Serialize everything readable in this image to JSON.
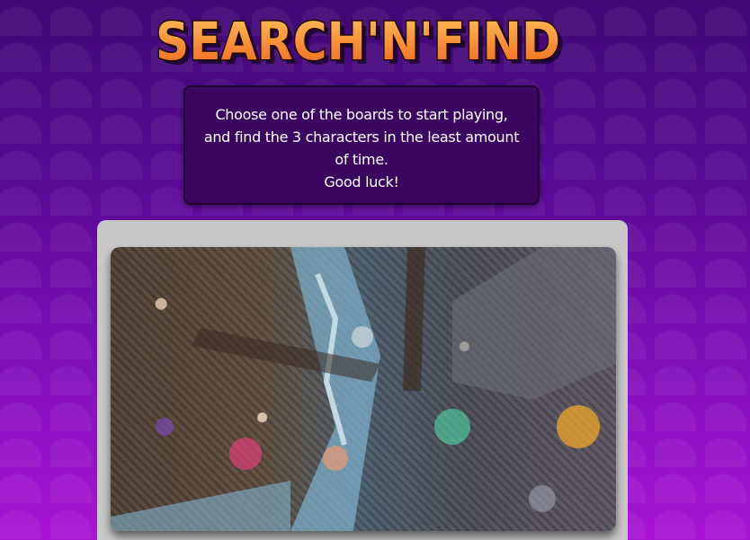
{
  "header": {
    "logo_text": "SEARCH'N'FIND"
  },
  "intro": {
    "line1": "Choose one of the boards to start playing, and find the 3 characters in the least amount of time.",
    "line2": "Good luck!"
  },
  "boards": [
    {
      "image_icon": "crowded-pirate-battle-illustration"
    }
  ],
  "colors": {
    "logo_fill_top": "#ffb347",
    "logo_fill_bottom": "#f06a1c",
    "logo_outline": "#1b0a05",
    "intro_bg": "#3a0660",
    "card_bg": "#c8c8c8",
    "page_bg_top": "#3f0874",
    "page_bg_bottom": "#a914d4"
  }
}
